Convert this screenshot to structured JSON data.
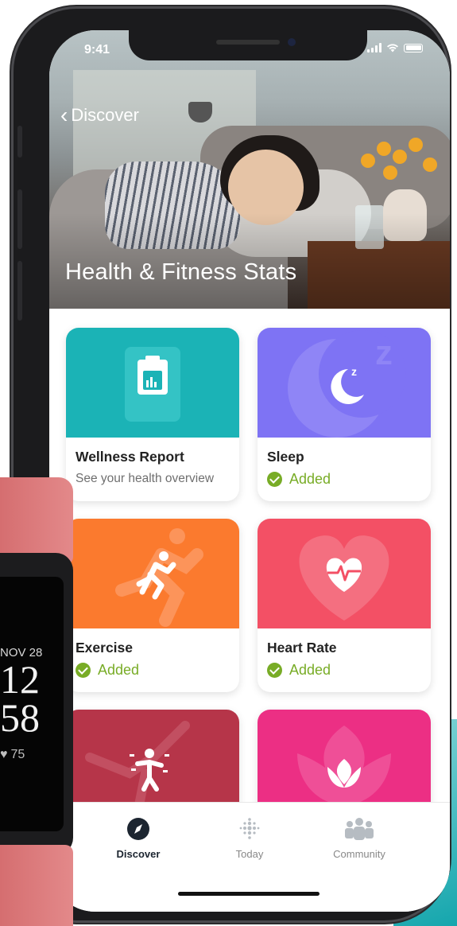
{
  "status_bar": {
    "time": "9:41"
  },
  "nav": {
    "back_label": "Discover"
  },
  "hero": {
    "title": "Health & Fitness Stats"
  },
  "cards": [
    {
      "title": "Wellness Report",
      "subtitle": "See your health overview",
      "color": "#1bb3b6",
      "icon": "clipboard-chart-icon"
    },
    {
      "title": "Sleep",
      "status": "Added",
      "color": "#7e73f4",
      "icon": "moon-zz-icon"
    },
    {
      "title": "Exercise",
      "status": "Added",
      "color": "#fb7a2e",
      "icon": "running-person-icon"
    },
    {
      "title": "Heart Rate",
      "status": "Added",
      "color": "#f35065",
      "icon": "heart-pulse-icon"
    },
    {
      "title": "",
      "color": "#b63549",
      "icon": "stretching-person-icon"
    },
    {
      "title": "",
      "color": "#ec2f84",
      "icon": "lotus-icon"
    }
  ],
  "tabbar": {
    "tabs": [
      {
        "label": "Discover",
        "icon": "compass-icon",
        "active": true
      },
      {
        "label": "Today",
        "icon": "dots-logo-icon",
        "active": false
      },
      {
        "label": "Community",
        "icon": "people-icon",
        "active": false
      }
    ]
  },
  "watch": {
    "date": "NOV 28",
    "hour": "12",
    "minute": "58",
    "heart_rate": "75"
  },
  "colors": {
    "added_green": "#78ac26",
    "accent_dark": "#1c2530"
  }
}
